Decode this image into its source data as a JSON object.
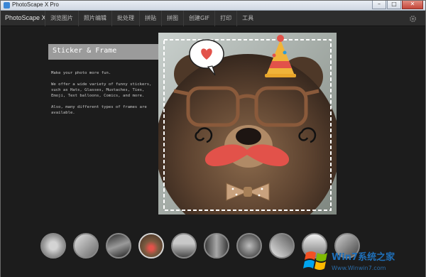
{
  "window": {
    "title": "PhotoScape X Pro",
    "minimize": "–",
    "maximize": "□",
    "close": "✕"
  },
  "menubar": {
    "brand": "PhotoScape X",
    "items": [
      "浏览图片",
      "照片编辑",
      "批处理",
      "拼贴",
      "拼图",
      "创建GIF",
      "打印",
      "工具"
    ],
    "settings_icon": "gear-icon"
  },
  "feature": {
    "heading": "Sticker & Frame",
    "paragraphs": [
      "Make your photo more fun.",
      "We offer a wide variety of funny stickers, such as Hats, Glasses, Mustaches, Ties, Emoji, Text balloons, Comics, and more.",
      "Also, many different types of frames are available."
    ]
  },
  "preview": {
    "stickers": [
      "heart-balloon",
      "party-hat",
      "glasses",
      "mustache",
      "bowtie",
      "swirls"
    ]
  },
  "thumbnails": {
    "count": 10,
    "selected_index": 3
  },
  "watermark": {
    "brand": "Win7系统之家",
    "url": "Www.Winwin7.com"
  },
  "colors": {
    "background": "#1c1c1c",
    "menubar": "#2d2d2d",
    "heading_box": "#9b9b9b",
    "mustache": "#e2524a",
    "hat": "#f0b43a"
  }
}
